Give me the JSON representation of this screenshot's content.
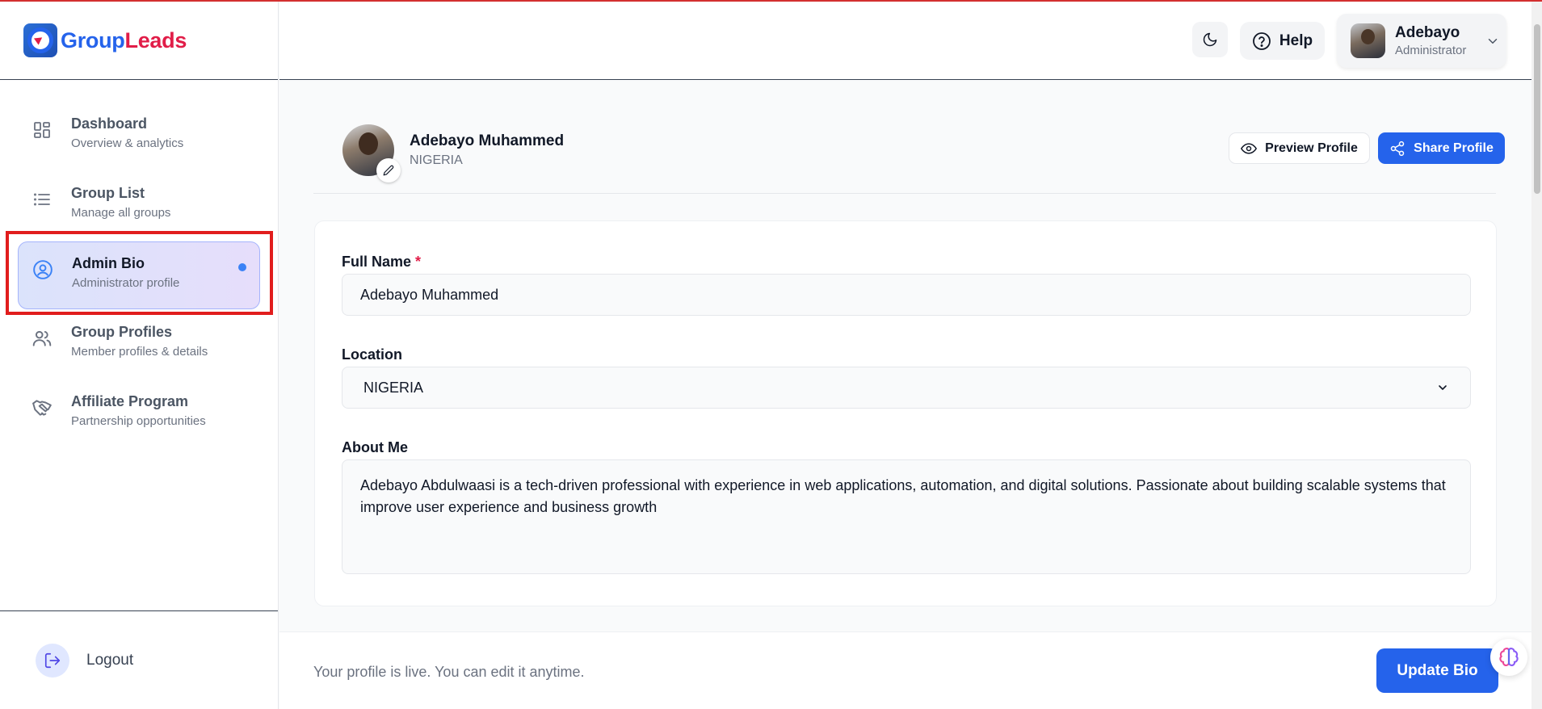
{
  "brand": {
    "prefix": "Group",
    "suffix": "Leads"
  },
  "sidebar": {
    "items": [
      {
        "label": "Dashboard",
        "sublabel": "Overview & analytics",
        "icon": "grid-icon"
      },
      {
        "label": "Group List",
        "sublabel": "Manage all groups",
        "icon": "list-icon"
      },
      {
        "label": "Admin Bio",
        "sublabel": "Administrator profile",
        "icon": "user-circle-icon",
        "active": true
      },
      {
        "label": "Group Profiles",
        "sublabel": "Member profiles & details",
        "icon": "users-icon"
      },
      {
        "label": "Affiliate Program",
        "sublabel": "Partnership opportunities",
        "icon": "handshake-icon"
      }
    ],
    "logout_label": "Logout"
  },
  "header": {
    "help_label": "Help",
    "user": {
      "name": "Adebayo",
      "role": "Administrator"
    }
  },
  "profile": {
    "name": "Adebayo Muhammed",
    "country": "NIGERIA",
    "preview_label": "Preview Profile",
    "share_label": "Share Profile"
  },
  "form": {
    "full_name_label": "Full Name",
    "required_mark": "*",
    "full_name_value": "Adebayo Muhammed",
    "location_label": "Location",
    "location_value": "NIGERIA",
    "about_label": "About Me",
    "about_value": "Adebayo Abdulwaasi is a tech-driven professional with experience in web applications, automation, and digital solutions. Passionate about building scalable systems that improve user experience and business growth"
  },
  "footer": {
    "status_message": "Your profile is live. You can edit it anytime.",
    "update_label": "Update Bio"
  },
  "colors": {
    "primary": "#2563eb",
    "accent_red": "#e11d48",
    "highlight": "#e11d1d"
  }
}
